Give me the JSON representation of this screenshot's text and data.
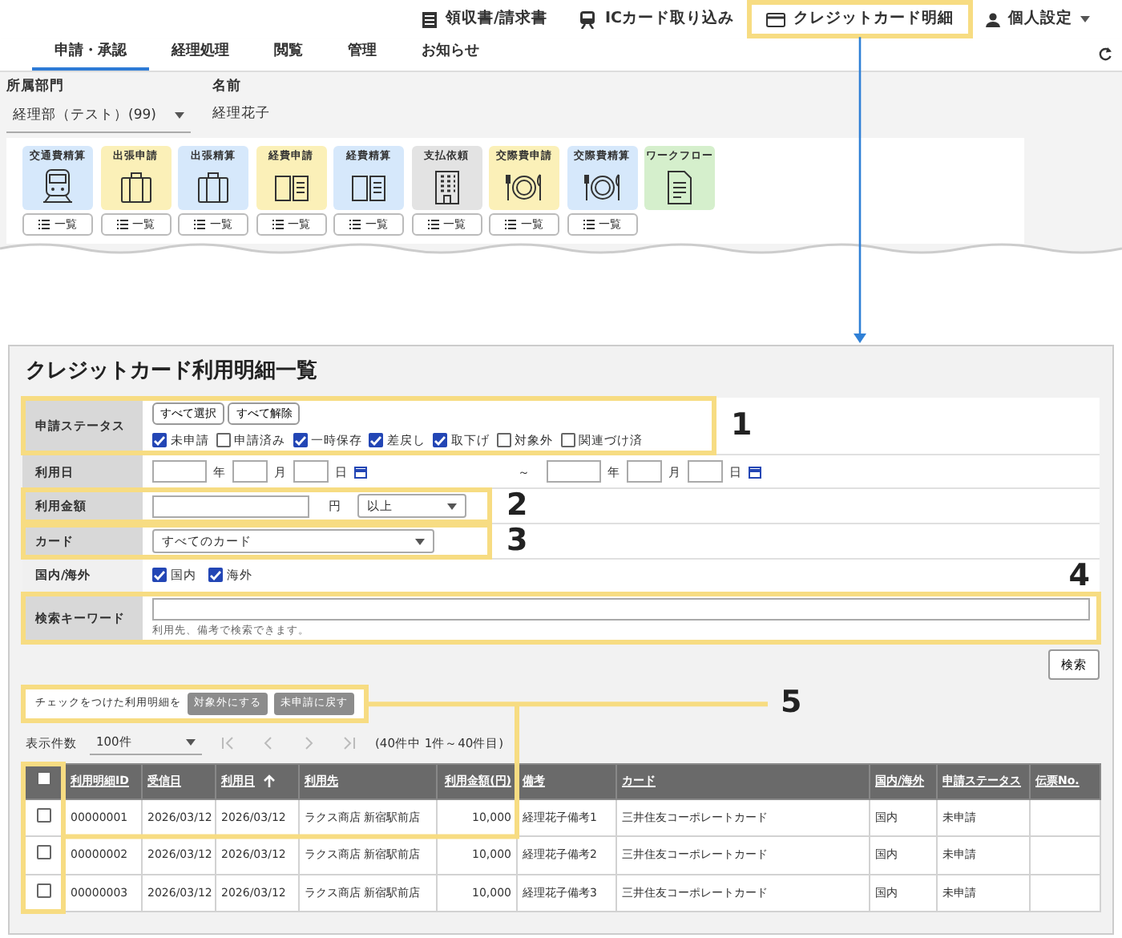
{
  "top_screen": {
    "header_links": [
      {
        "label": "領収書/請求書",
        "highlighted": false
      },
      {
        "label": "ICカード取り込み",
        "highlighted": false
      },
      {
        "label": "クレジットカード明細",
        "highlighted": true
      }
    ],
    "user_menu": {
      "label": "個人設定"
    },
    "tabs": [
      {
        "label": "申請・承認",
        "selected": true
      },
      {
        "label": "経理処理",
        "selected": false
      },
      {
        "label": "閲覧",
        "selected": false
      },
      {
        "label": "管理",
        "selected": false
      },
      {
        "label": "お知らせ",
        "selected": false
      }
    ],
    "department": {
      "label": "所属部門",
      "value": "経理部（テスト）(99)"
    },
    "name": {
      "label": "名前",
      "value": "経理花子"
    },
    "tiles": [
      {
        "label": "交通費精算",
        "color": "#d6e8fb",
        "button": "一覧"
      },
      {
        "label": "出張申請",
        "color": "#fbf0b8",
        "button": "一覧"
      },
      {
        "label": "出張精算",
        "color": "#d6e8fb",
        "button": "一覧"
      },
      {
        "label": "経費申請",
        "color": "#fbf0b8",
        "button": "一覧"
      },
      {
        "label": "経費精算",
        "color": "#d6e8fb",
        "button": "一覧"
      },
      {
        "label": "支払依頼",
        "color": "#e3e3e3",
        "button": "一覧"
      },
      {
        "label": "交際費申請",
        "color": "#fbf0b8",
        "button": "一覧"
      },
      {
        "label": "交際費精算",
        "color": "#d6e8fb",
        "button": "一覧"
      },
      {
        "label": "ワークフロー",
        "color": "#d5efcc"
      }
    ]
  },
  "detail_screen": {
    "title": "クレジットカード利用明細一覧",
    "status_filter": {
      "label": "申請ステータス",
      "callout": "1",
      "buttons": [
        "すべて選択",
        "すべて解除"
      ],
      "options": [
        {
          "label": "未申請",
          "checked": true
        },
        {
          "label": "申請済み",
          "checked": false
        },
        {
          "label": "一時保存",
          "checked": true
        },
        {
          "label": "差戻し",
          "checked": true
        },
        {
          "label": "取下げ",
          "checked": true
        },
        {
          "label": "対象外",
          "checked": false
        },
        {
          "label": "関連づけ済",
          "checked": false
        }
      ]
    },
    "date_filter": {
      "label": "利用日",
      "ranges": [
        {
          "units": [
            "年",
            "月",
            "日"
          ]
        },
        {
          "units": [
            "年",
            "月",
            "日"
          ]
        }
      ],
      "separator": "～"
    },
    "amount_filter": {
      "label": "利用金額",
      "callout": "2",
      "unit": "円",
      "condition": "以上"
    },
    "card_filter": {
      "label": "カード",
      "callout": "3",
      "value": "すべてのカード"
    },
    "region_filter": {
      "label": "国内/海外",
      "options": [
        {
          "label": "国内",
          "checked": true
        },
        {
          "label": "海外",
          "checked": true
        }
      ]
    },
    "keyword_filter": {
      "label": "検索キーワード",
      "callout": "4",
      "hint": "利用先、備考で検索できます。"
    },
    "search_button": "検索",
    "bulk_actions": {
      "callout": "5",
      "label": "チェックをつけた利用明細を",
      "buttons": [
        {
          "label": "対象外にする",
          "disabled": true
        },
        {
          "label": "未申請に戻す",
          "disabled": true
        }
      ]
    },
    "pagination": {
      "label": "表示件数",
      "page_size": "100件",
      "summary": "(40件中 1件～40件目)"
    },
    "table": {
      "header_checked": false,
      "columns": [
        {
          "label": "利用明細ID",
          "sorted": false,
          "numeric": false
        },
        {
          "label": "受信日",
          "sorted": false,
          "numeric": false
        },
        {
          "label": "利用日",
          "sorted": true,
          "numeric": false
        },
        {
          "label": "利用先",
          "sorted": false,
          "numeric": false
        },
        {
          "label": "利用金額(円)",
          "sorted": false,
          "numeric": true
        },
        {
          "label": "備考",
          "sorted": false,
          "numeric": false
        },
        {
          "label": "カード",
          "sorted": false,
          "numeric": false
        },
        {
          "label": "国内/海外",
          "sorted": false,
          "numeric": false
        },
        {
          "label": "申請ステータス",
          "sorted": false,
          "numeric": false
        },
        {
          "label": "伝票No.",
          "sorted": false,
          "numeric": false
        }
      ],
      "rows": [
        {
          "checked": false,
          "cells": [
            "00000001",
            "2026/03/12",
            "2026/03/12",
            "ラクス商店 新宿駅前店",
            "10,000",
            "経理花子備考1",
            "三井住友コーポレートカード",
            "国内",
            "未申請",
            ""
          ]
        },
        {
          "checked": false,
          "cells": [
            "00000002",
            "2026/03/12",
            "2026/03/12",
            "ラクス商店 新宿駅前店",
            "10,000",
            "経理花子備考2",
            "三井住友コーポレートカード",
            "国内",
            "未申請",
            ""
          ]
        },
        {
          "checked": false,
          "cells": [
            "00000003",
            "2026/03/12",
            "2026/03/12",
            "ラクス商店 新宿駅前店",
            "10,000",
            "経理花子備考3",
            "三井住友コーポレートカード",
            "国内",
            "未申請",
            ""
          ]
        }
      ]
    }
  }
}
